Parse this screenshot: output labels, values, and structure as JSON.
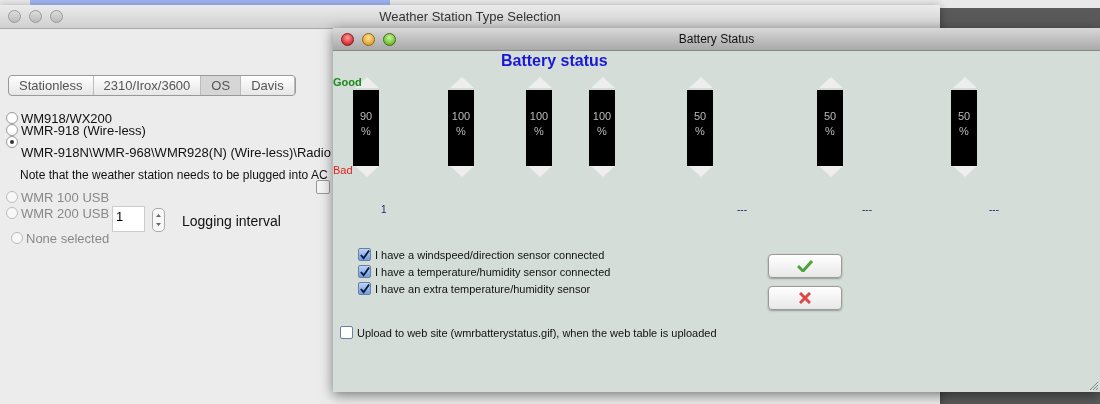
{
  "back_window": {
    "title": "Weather Station Type Selection",
    "tabs": [
      {
        "label": "Stationless",
        "selected": false
      },
      {
        "label": "2310/Irox/3600",
        "selected": false
      },
      {
        "label": "OS",
        "selected": true
      },
      {
        "label": "Davis",
        "selected": false
      }
    ],
    "stations": [
      {
        "label": "WM918/WX200",
        "selected": false,
        "disabled": false
      },
      {
        "label": "WMR-918 (Wire-less)",
        "selected": false,
        "disabled": false
      },
      {
        "label": "WMR-918N\\WMR-968\\WMR928(N) (Wire-less)\\Radio",
        "selected": true,
        "disabled": false
      }
    ],
    "note": "Note that the weather station needs to be plugged into AC",
    "note_checkbox": {
      "checked": false
    },
    "usb_stations": [
      {
        "label": "WMR 100 USB",
        "selected": false,
        "disabled": true
      },
      {
        "label": "WMR 200 USB",
        "selected": false,
        "disabled": true
      }
    ],
    "logging_interval": {
      "value": "1",
      "label": "Logging interval"
    },
    "none_option": {
      "label": "None selected",
      "selected": false,
      "disabled": true
    }
  },
  "battery_window": {
    "title": "Battery Status",
    "heading": "Battery status",
    "good_label": "Good",
    "bad_label": "Bad",
    "batteries": [
      {
        "value": "90",
        "unit": "%"
      },
      {
        "value": "100",
        "unit": "%"
      },
      {
        "value": "100",
        "unit": "%"
      },
      {
        "value": "100",
        "unit": "%"
      },
      {
        "value": "50",
        "unit": "%"
      },
      {
        "value": "50",
        "unit": "%"
      },
      {
        "value": "50",
        "unit": "%"
      }
    ],
    "channel_labels": [
      "1",
      "---",
      "---",
      "---"
    ],
    "sensors": [
      {
        "label": "I have a windspeed/direction sensor connected",
        "checked": true
      },
      {
        "label": "I have a temperature/humidity sensor connected",
        "checked": true
      },
      {
        "label": "I have an extra temperature/humidity sensor",
        "checked": true
      }
    ],
    "upload": {
      "label": "Upload to web site (wmrbatterystatus.gif), when the web table is uploaded",
      "checked": false
    }
  }
}
